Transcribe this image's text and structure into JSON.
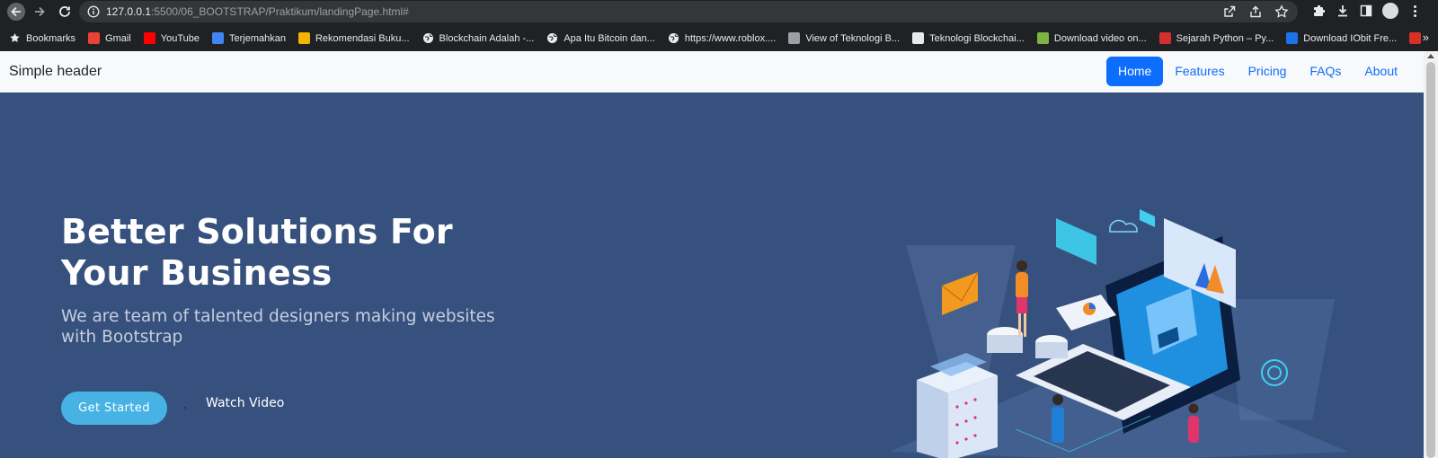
{
  "browser": {
    "url_host": "127.0.0.1",
    "url_rest": ":5500/06_BOOTSTRAP/Praktikum/landingPage.html#",
    "bookmarks": [
      {
        "label": "Bookmarks",
        "icon": "star-icon",
        "color": "#e8eaed"
      },
      {
        "label": "Gmail",
        "icon": "gmail-icon",
        "color": "#ea4335"
      },
      {
        "label": "YouTube",
        "icon": "youtube-icon",
        "color": "#ff0000"
      },
      {
        "label": "Terjemahkan",
        "icon": "translate-icon",
        "color": "#4285f4"
      },
      {
        "label": "Rekomendasi Buku...",
        "icon": "book-icon",
        "color": "#f4b400"
      },
      {
        "label": "Blockchain Adalah -...",
        "icon": "globe-icon",
        "color": "#e8eaed"
      },
      {
        "label": "Apa Itu Bitcoin dan...",
        "icon": "globe-icon",
        "color": "#e8eaed"
      },
      {
        "label": "https://www.roblox....",
        "icon": "globe-icon",
        "color": "#e8eaed"
      },
      {
        "label": "View of Teknologi B...",
        "icon": "journal-icon",
        "color": "#9aa0a6"
      },
      {
        "label": "Teknologi Blockchai...",
        "icon": "d-icon",
        "color": "#e8eaed"
      },
      {
        "label": "Download video on...",
        "icon": "download-arrow-icon",
        "color": "#7cb342"
      },
      {
        "label": "Sejarah Python – Py...",
        "icon": "python-site-icon",
        "color": "#d32f2f"
      },
      {
        "label": "Download IObit Fre...",
        "icon": "iobit-icon",
        "color": "#1a73e8"
      },
      {
        "label": "",
        "icon": "red-site-icon",
        "color": "#d93025"
      }
    ]
  },
  "header": {
    "brand": "Simple header",
    "nav": [
      {
        "label": "Home",
        "active": true
      },
      {
        "label": "Features",
        "active": false
      },
      {
        "label": "Pricing",
        "active": false
      },
      {
        "label": "FAQs",
        "active": false
      },
      {
        "label": "About",
        "active": false
      }
    ]
  },
  "hero": {
    "title": "Better Solutions For Your Business",
    "subtitle": "We are team of talented designers making websites with Bootstrap",
    "cta_label": "Get Started",
    "video_label": "Watch Video",
    "illustration": "isometric-laptop-server-illustration"
  },
  "colors": {
    "hero_bg": "#37517e",
    "cta": "#47b2e4",
    "primary": "#0d6efd",
    "header_bg": "#f8f9fa"
  }
}
